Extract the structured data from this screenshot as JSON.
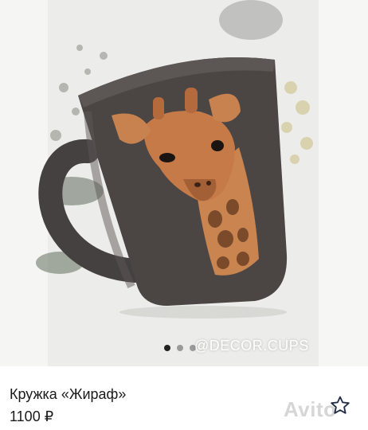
{
  "listing": {
    "title": "Кружка «Жираф»",
    "price": "1100 ₽",
    "watermark": "@DECOR.CUPS",
    "brand_watermark": "Avito",
    "gallery": {
      "total_images": 3,
      "active_index": 0
    }
  },
  "icons": {
    "favorite": "star-outline-icon"
  },
  "colors": {
    "mug": "#4a4543",
    "giraffe": "#c57a48",
    "background": "#eaeaea"
  }
}
